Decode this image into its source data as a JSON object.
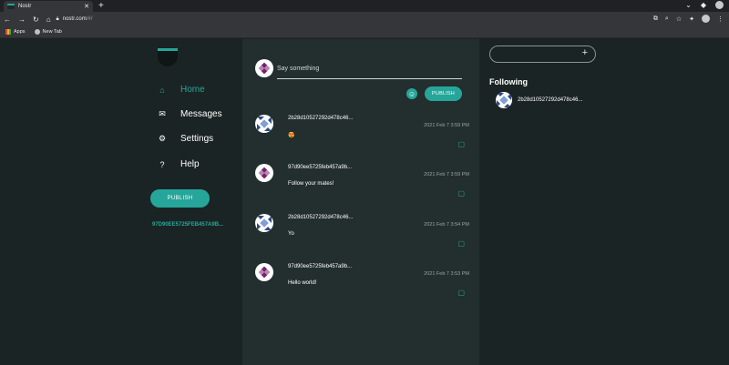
{
  "browser": {
    "tab_title": "Nostr",
    "tab_close": "✕",
    "new_tab": "+",
    "url_host": "nostr.com",
    "url_path": "/#/",
    "bookmarks": [
      {
        "label": "Apps",
        "icon": "apps-grid-icon"
      },
      {
        "label": "New Tab",
        "icon": "globe-icon"
      }
    ]
  },
  "nav": {
    "items": [
      {
        "label": "Home",
        "icon": "home-icon",
        "active": true
      },
      {
        "label": "Messages",
        "icon": "mail-icon",
        "active": false
      },
      {
        "label": "Settings",
        "icon": "gear-icon",
        "active": false
      },
      {
        "label": "Help",
        "icon": "help-icon",
        "active": false
      }
    ],
    "publish_label": "PUBLISH",
    "pubkey": "97D90EE5725FEB457A9B..."
  },
  "compose": {
    "placeholder": "Say something",
    "publish_label": "PUBLISH",
    "emoji_icon": "emoji-icon"
  },
  "feed": [
    {
      "author": "2b28d10527292d478c46...",
      "time": "2021 Feb 7 3:59 PM",
      "content": "😍",
      "avatar": "blue-identicon"
    },
    {
      "author": "97d90ee5725feb457a9b...",
      "time": "2021 Feb 7 3:59 PM",
      "content": "Follow your mates!",
      "avatar": "purple-identicon"
    },
    {
      "author": "2b28d10527292d478c46...",
      "time": "2021 Feb 7 3:54 PM",
      "content": "Yo",
      "avatar": "blue-identicon"
    },
    {
      "author": "97d90ee5725feb457a9b...",
      "time": "2021 Feb 7 3:53 PM",
      "content": "Hello world!",
      "avatar": "purple-identicon"
    }
  ],
  "sidebar": {
    "search_placeholder": "",
    "add_icon": "+",
    "following_title": "Following",
    "following": [
      {
        "name": "2b28d10527292d478c46...",
        "avatar": "blue-identicon"
      }
    ]
  },
  "colors": {
    "accent": "#26a69a",
    "bg_dark": "#1b2424",
    "bg_feed": "#232e2e"
  }
}
